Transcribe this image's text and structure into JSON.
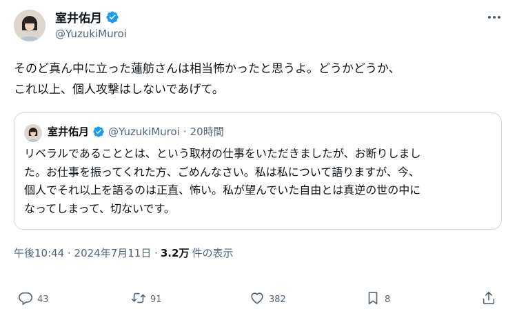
{
  "tweet": {
    "author": {
      "name": "室井佑月",
      "handle": "@YuzukiMuroi"
    },
    "text_lines": [
      "そのど真ん中に立った蓮舫さんは相当怖かったと思うよ。どうかどうか、",
      "これ以上、個人攻撃はしないであげて。"
    ],
    "quote": {
      "name": "室井佑月",
      "handle": "@YuzukiMuroi",
      "dot": "·",
      "time": "20時間",
      "text_lines": [
        "リベラルであることとは、という取材の仕事をいただきましたが、お断りしまし",
        "た。お仕事を振ってくれた方、ごめんなさい。私は私について語りますが、今、",
        "個人でそれ以上を語るのは正直、怖い。私が望んでいた自由とは真逆の世の中に",
        "なってしまって、切ないです。"
      ]
    },
    "meta": {
      "time": "午後10:44 · 2024年7月11日 ·",
      "views_count": "3.2万",
      "views_label": "件の表示"
    },
    "actions": {
      "replies": "43",
      "reposts": "91",
      "likes": "382",
      "bookmarks": "8"
    }
  },
  "colors": {
    "text": "#0f1419",
    "secondary": "#536471",
    "verified": "#1d9bf0",
    "border": "#cfd9de"
  },
  "icons": [
    "verified-badge-icon",
    "more-icon",
    "reply-icon",
    "repost-icon",
    "like-icon",
    "bookmark-icon",
    "share-icon"
  ]
}
